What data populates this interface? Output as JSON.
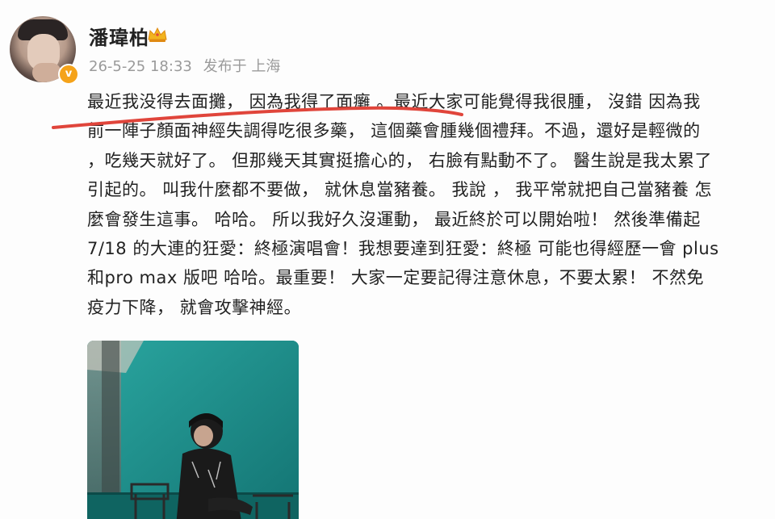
{
  "post": {
    "author": {
      "name": "潘瑋柏",
      "avatar_icon": "user-avatar",
      "verified_icon": "verified-v-badge",
      "crown_icon": "crown-icon",
      "verified_mark": "v"
    },
    "meta": {
      "timestamp": "26-5-25 18:33",
      "posted_from": "发布于 上海"
    },
    "text_lines": [
      "最近我没得去面攤， 因為我得了面癱 。最近大家可能覺得我很腫， 沒錯 因為我",
      "前一陣子顏面神經失調得吃很多藥， 這個藥會腫幾個禮拜。不過，還好是輕微的",
      "，吃幾天就好了。 但那幾天其實挺擔心的， 右臉有點動不了。 醫生說是我太累了",
      "引起的。 叫我什麼都不要做， 就休息當豬養。 我說 ， 我平常就把自己當豬養 怎",
      "麼會發生這事。 哈哈。 所以我好久沒運動， 最近終於可以開始啦！ 然後準備起",
      "7/18 的大連的狂愛：終極演唱會！我想要達到狂愛：終極 可能也得經歷一會 plus",
      "和pro max 版吧 哈哈。最重要！ 大家一定要記得注意休息，不要太累！ 不然免",
      "疫力下降， 就會攻擊神經。"
    ],
    "image": {
      "description_icon": "post-photo",
      "accent_color": "#1f8f8d"
    }
  },
  "colors": {
    "text": "#222222",
    "meta": "#9a9a9a",
    "annotation": "#e0453b",
    "badge": "#f5a31a"
  }
}
